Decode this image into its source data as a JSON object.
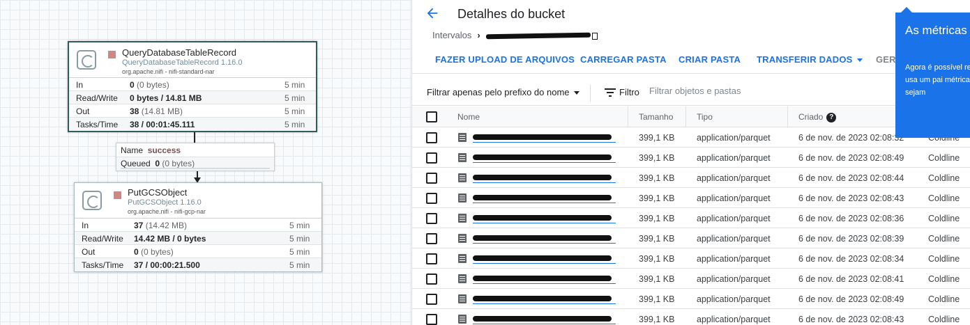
{
  "nifi": {
    "processors": [
      {
        "name": "QueryDatabaseTableRecord",
        "type": "QueryDatabaseTableRecord 1.16.0",
        "bundle": "org.apache.nifi - nifi-standard-nar",
        "stats": [
          {
            "label": "In",
            "value": "0",
            "detail": " (0 bytes)",
            "period": "5 min"
          },
          {
            "label": "Read/Write",
            "value": "0 bytes / 14.81 MB",
            "detail": "",
            "period": "5 min"
          },
          {
            "label": "Out",
            "value": "38",
            "detail": " (14.81 MB)",
            "period": "5 min"
          },
          {
            "label": "Tasks/Time",
            "value": "38 / 00:01:45.111",
            "detail": "",
            "period": "5 min"
          }
        ]
      },
      {
        "name": "PutGCSObject",
        "type": "PutGCSObject 1.16.0",
        "bundle": "org.apache.nifi - nifi-gcp-nar",
        "stats": [
          {
            "label": "In",
            "value": "37",
            "detail": " (14.42 MB)",
            "period": "5 min"
          },
          {
            "label": "Read/Write",
            "value": "14.42 MB / 0 bytes",
            "detail": "",
            "period": "5 min"
          },
          {
            "label": "Out",
            "value": "0",
            "detail": " (0 bytes)",
            "period": "5 min"
          },
          {
            "label": "Tasks/Time",
            "value": "37 / 00:00:21.500",
            "detail": "",
            "period": "5 min"
          }
        ]
      }
    ],
    "connection": {
      "name_label": "Name",
      "name_value": "success",
      "queued_label": "Queued",
      "queued_value": "0",
      "queued_detail": " (0 bytes)"
    }
  },
  "gcs": {
    "title": "Detalhes do bucket",
    "breadcrumb_root": "Intervalos",
    "actions": {
      "upload_files": "FAZER UPLOAD DE ARQUIVOS",
      "upload_folder": "CARREGAR PASTA",
      "create_folder": "CRIAR PASTA",
      "transfer_data": "TRANSFERIR DADOS",
      "more": "GER"
    },
    "filter": {
      "prefix_label": "Filtrar apenas pelo prefixo do nome",
      "filter_label": "Filtro",
      "placeholder": "Filtrar objetos e pastas"
    },
    "table": {
      "headers": {
        "name": "Nome",
        "size": "Tamanho",
        "type": "Tipo",
        "created": "Criado"
      },
      "rows": [
        {
          "size": "399,1 KB",
          "type": "application/parquet",
          "created": "6 de nov. de 2023 02:08:32",
          "class": "Coldline"
        },
        {
          "size": "399,1 KB",
          "type": "application/parquet",
          "created": "6 de nov. de 2023 02:08:49",
          "class": "Coldline"
        },
        {
          "size": "399,1 KB",
          "type": "application/parquet",
          "created": "6 de nov. de 2023 02:08:44",
          "class": "Coldline"
        },
        {
          "size": "399,1 KB",
          "type": "application/parquet",
          "created": "6 de nov. de 2023 02:08:43",
          "class": "Coldline"
        },
        {
          "size": "399,1 KB",
          "type": "application/parquet",
          "created": "6 de nov. de 2023 02:08:36",
          "class": "Coldline"
        },
        {
          "size": "399,1 KB",
          "type": "application/parquet",
          "created": "6 de nov. de 2023 02:08:39",
          "class": "Coldline"
        },
        {
          "size": "399,1 KB",
          "type": "application/parquet",
          "created": "6 de nov. de 2023 02:08:34",
          "class": "Coldline"
        },
        {
          "size": "399,1 KB",
          "type": "application/parquet",
          "created": "6 de nov. de 2023 02:08:41",
          "class": "Coldline"
        },
        {
          "size": "399,1 KB",
          "type": "application/parquet",
          "created": "6 de nov. de 2023 02:08:49",
          "class": "Coldline"
        },
        {
          "size": "399,1 KB",
          "type": "application/parquet",
          "created": "6 de nov. de 2023 02:08:43",
          "class": "Coldline"
        }
      ]
    },
    "tooltip": {
      "title": "As métricas foram movic",
      "body": "Agora é possível replicação turbo você usa um pai métricas precisa para que sejam"
    }
  }
}
